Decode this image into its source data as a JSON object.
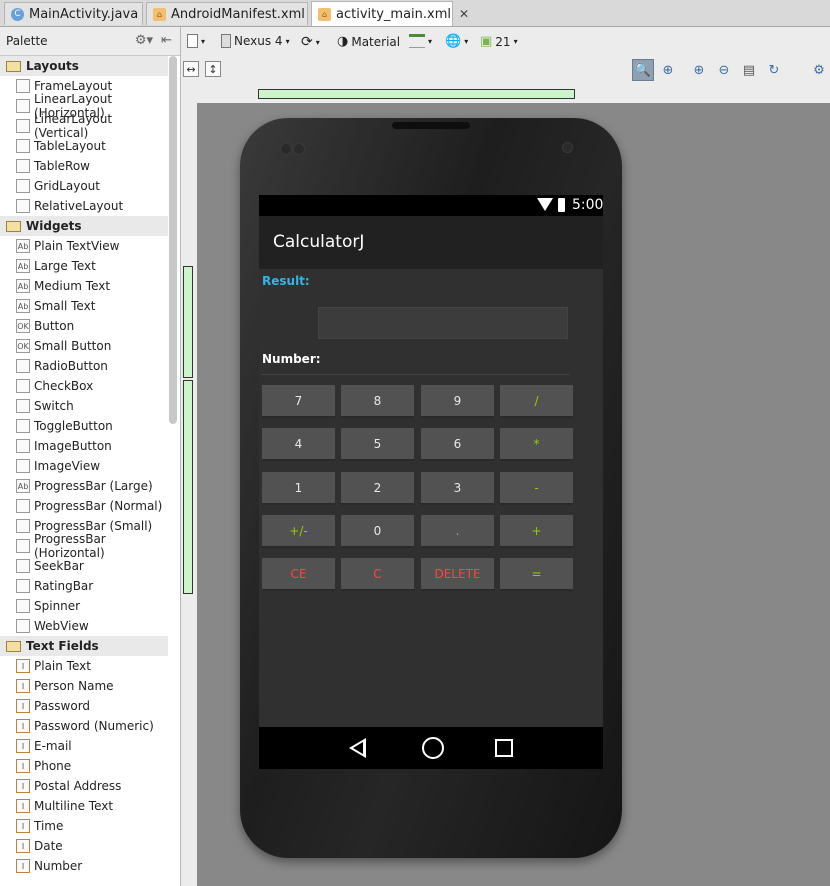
{
  "tabs": [
    {
      "label": "MainActivity.java",
      "icon": "C"
    },
    {
      "label": "AndroidManifest.xml",
      "icon": ""
    },
    {
      "label": "activity_main.xml",
      "icon": ""
    }
  ],
  "palette": {
    "title": "Palette",
    "groups": [
      {
        "name": "Layouts",
        "items": [
          "FrameLayout",
          "LinearLayout (Horizontal)",
          "LinearLayout (Vertical)",
          "TableLayout",
          "TableRow",
          "GridLayout",
          "RelativeLayout"
        ]
      },
      {
        "name": "Widgets",
        "items": [
          "Plain TextView",
          "Large Text",
          "Medium Text",
          "Small Text",
          "Button",
          "Small Button",
          "RadioButton",
          "CheckBox",
          "Switch",
          "ToggleButton",
          "ImageButton",
          "ImageView",
          "ProgressBar (Large)",
          "ProgressBar (Normal)",
          "ProgressBar (Small)",
          "ProgressBar (Horizontal)",
          "SeekBar",
          "RatingBar",
          "Spinner",
          "WebView"
        ]
      },
      {
        "name": "Text Fields",
        "items": [
          "Plain Text",
          "Person Name",
          "Password",
          "Password (Numeric)",
          "E-mail",
          "Phone",
          "Postal Address",
          "Multiline Text",
          "Time",
          "Date",
          "Number"
        ]
      }
    ]
  },
  "toolbar": {
    "device": "Nexus 4",
    "theme": "Material",
    "api": "21"
  },
  "app": {
    "time": "5:00",
    "title": "CalculatorJ",
    "result_label": "Result:",
    "number_label": "Number:",
    "keys": [
      [
        "7",
        "8",
        "9",
        "/"
      ],
      [
        "4",
        "5",
        "6",
        "*"
      ],
      [
        "1",
        "2",
        "3",
        "-"
      ],
      [
        "+/-",
        "0",
        ".",
        "+"
      ],
      [
        "CE",
        "C",
        "DELETE",
        "="
      ]
    ],
    "colors": {
      "operator": "#99cc00",
      "clear": "#ff4444",
      "accent": "#33b5e5"
    }
  }
}
